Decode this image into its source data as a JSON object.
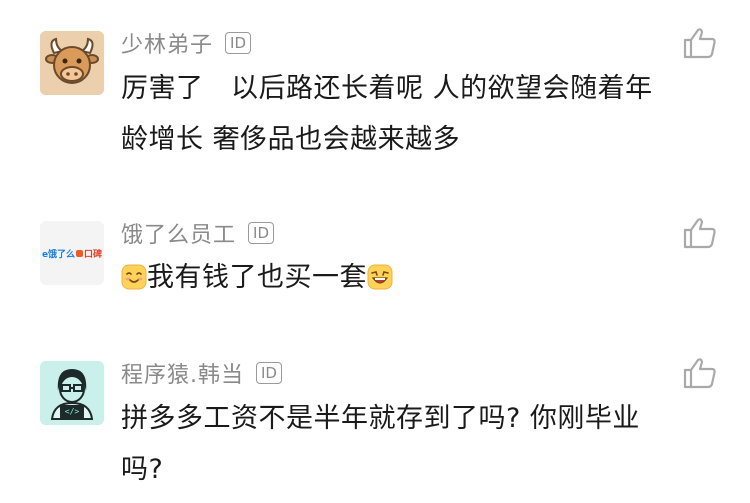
{
  "id_badge": "ID",
  "comments": [
    {
      "username": "少林弟子",
      "lines": [
        "厉害了　以后路还长着呢 人的欲望会随着年",
        "龄增长  奢侈品也会越来越多"
      ]
    },
    {
      "username": "饿了么员工",
      "avatar_text_left": "e饿了么",
      "avatar_text_right": "口碑",
      "text": "我有钱了也买一套"
    },
    {
      "username": "程序猿.韩当",
      "avatar_code": "</>",
      "lines": [
        "拼多多工资不是半年就存到了吗? 你刚毕业",
        "吗?"
      ]
    }
  ],
  "colors": {
    "username": "#8a8a8a",
    "text": "#1a1a1a",
    "like_icon": "#a9a9a9",
    "avatar1_bg": "#e8c9a4",
    "avatar2_bg": "#f4f4f4",
    "avatar3_bg": "#c7efe8"
  },
  "icons": {
    "like": "thumbs-up-icon",
    "emoji_left": "smiling-face-emoji",
    "emoji_right": "grinning-face-emoji"
  }
}
